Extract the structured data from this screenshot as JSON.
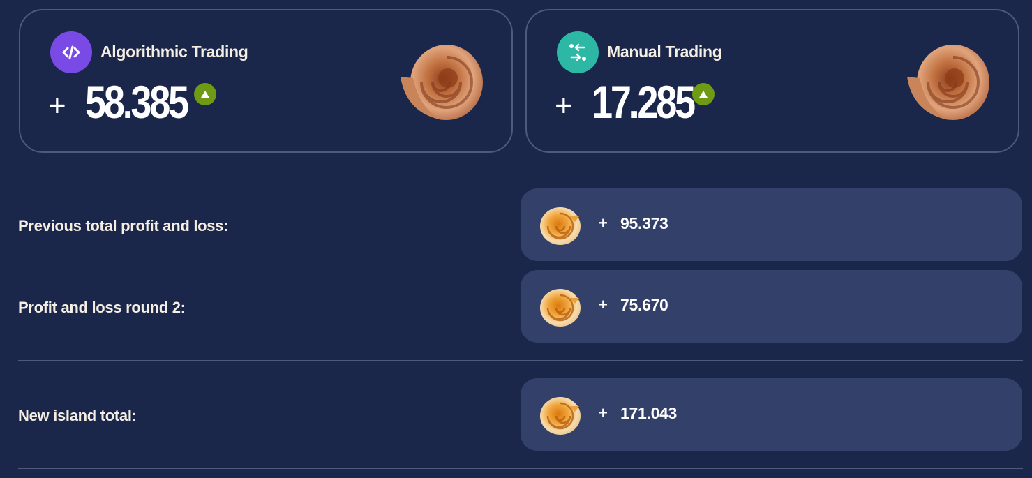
{
  "algorithmic": {
    "title": "Algorithmic Trading",
    "sign": "+",
    "value": "58.385",
    "icon": "code-icon",
    "accent": "#7a4ae6",
    "trend": "up"
  },
  "manual": {
    "title": "Manual Trading",
    "sign": "+",
    "value": "17.285",
    "icon": "swap-arrows-icon",
    "accent": "#2cb8a4",
    "trend": "up"
  },
  "rows": [
    {
      "label": "Previous total profit and loss:",
      "sign": "+",
      "value": "95.373",
      "icon": "shell-icon"
    },
    {
      "label": "Profit and loss round 2:",
      "sign": "+",
      "value": "75.670",
      "icon": "shell-icon"
    },
    {
      "label": "New island total:",
      "sign": "+",
      "value": "171.043",
      "icon": "shell-icon"
    }
  ],
  "colors": {
    "background": "#1b264b",
    "value_box": "#33416a",
    "trend_up": "#6f9a13"
  }
}
